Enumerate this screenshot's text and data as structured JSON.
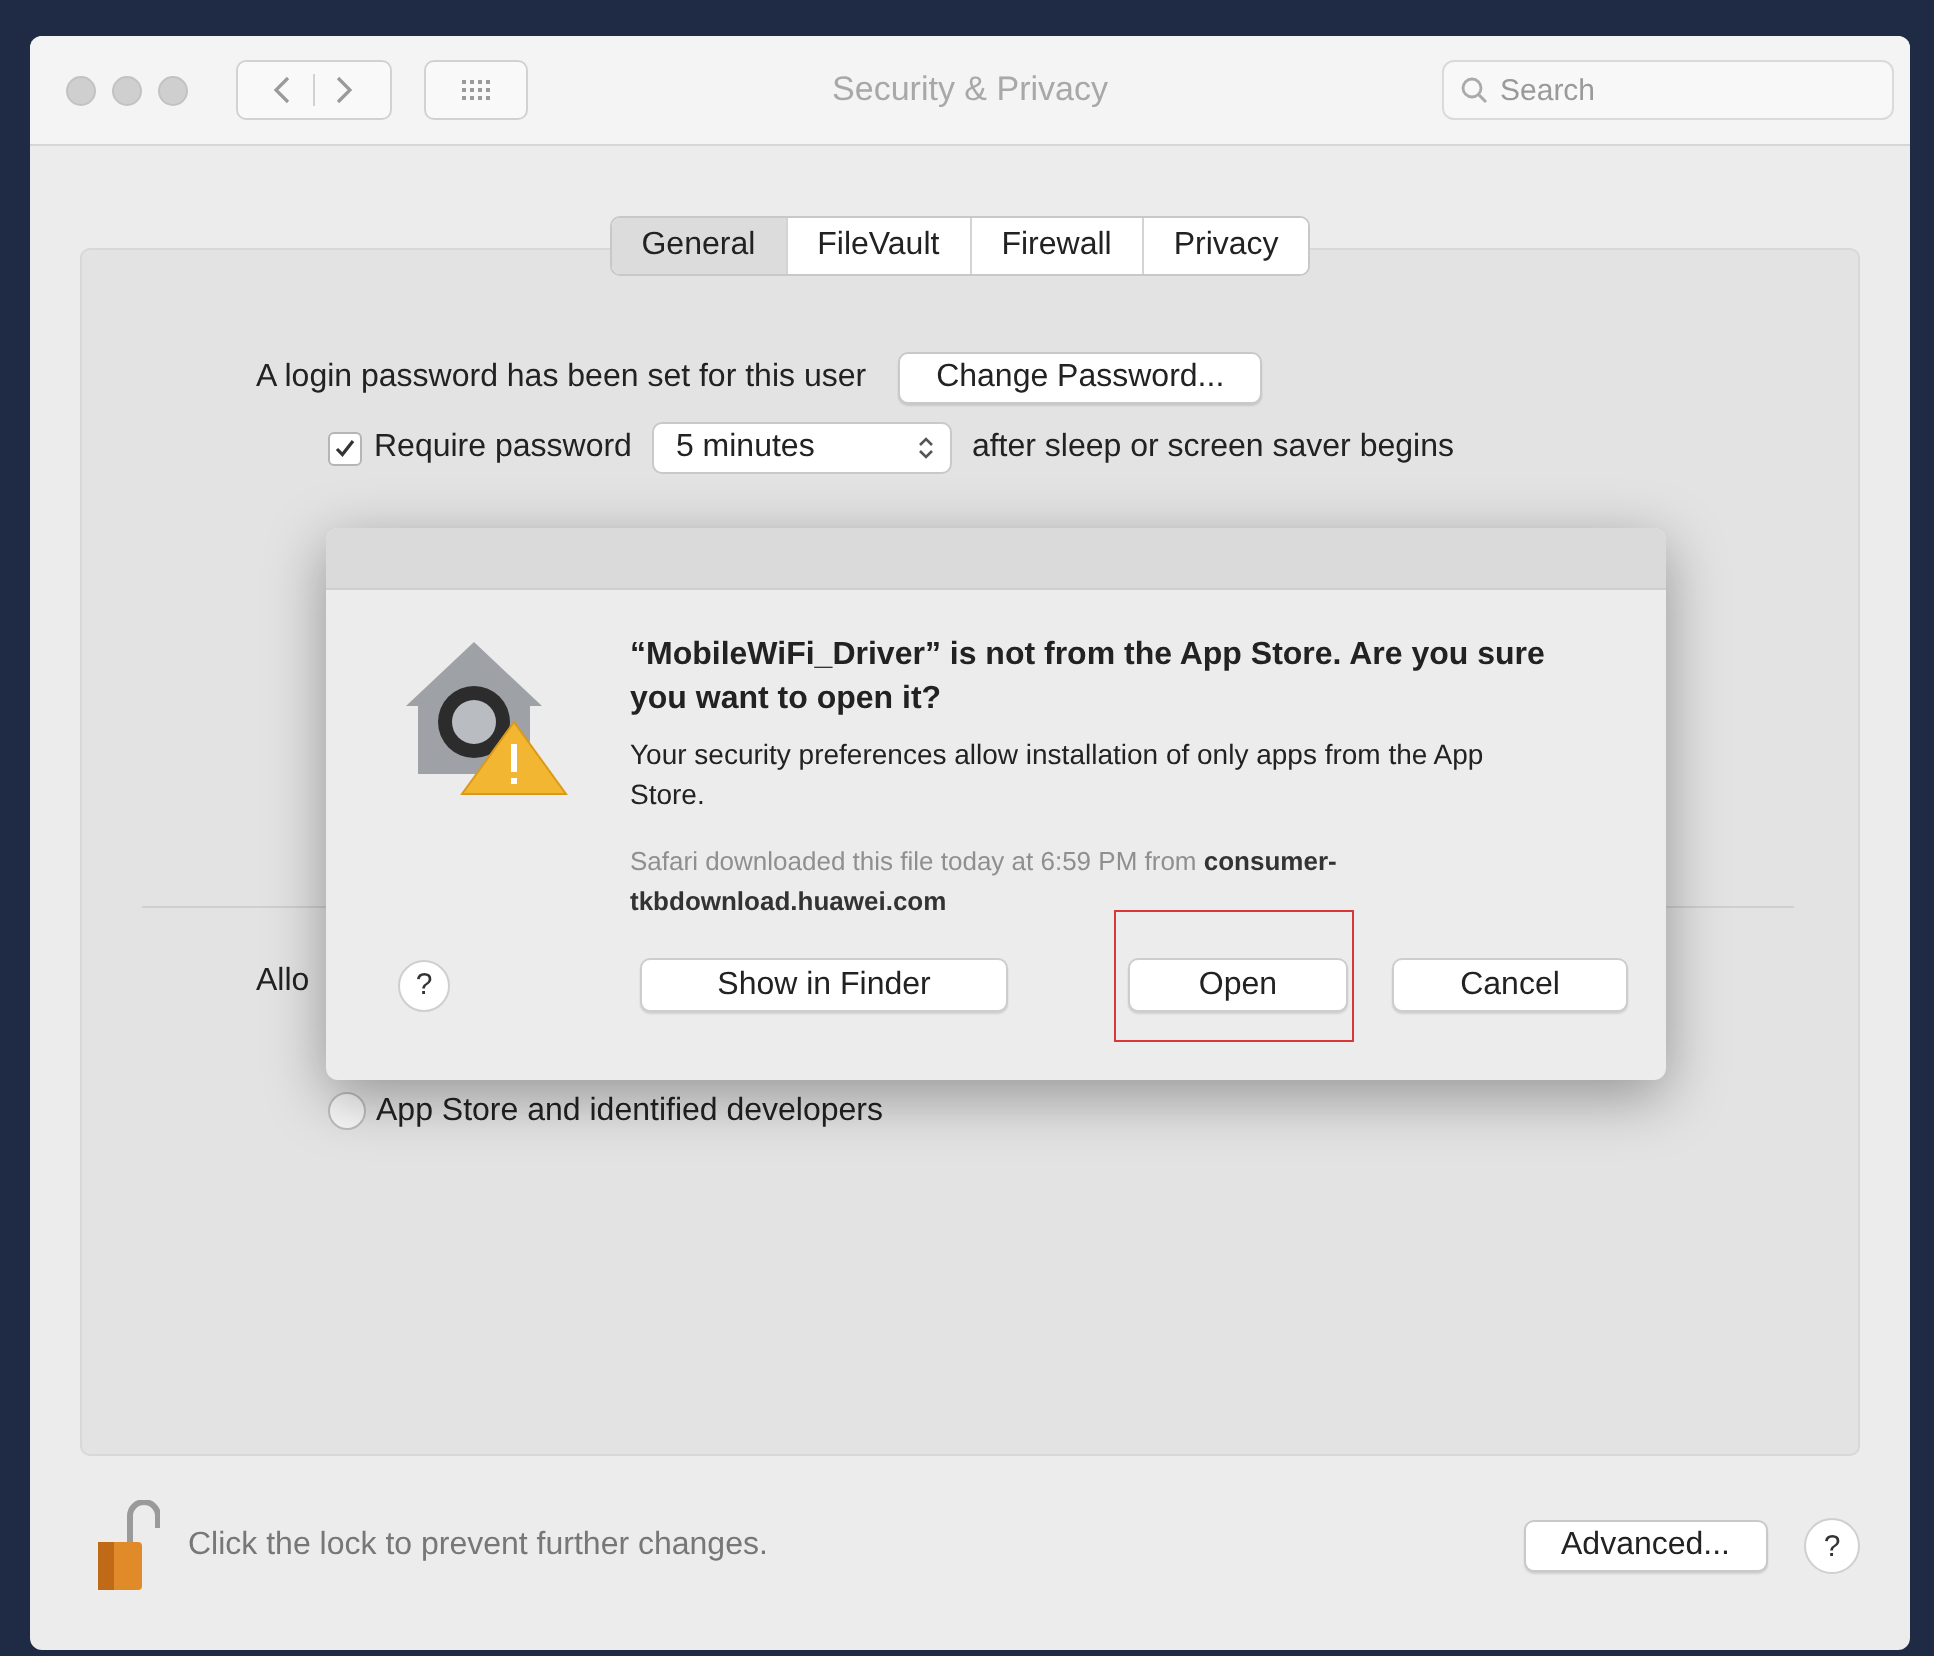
{
  "window": {
    "title": "Security & Privacy"
  },
  "search": {
    "placeholder": "Search"
  },
  "tabs": [
    {
      "label": "General",
      "selected": true
    },
    {
      "label": "FileVault",
      "selected": false
    },
    {
      "label": "Firewall",
      "selected": false
    },
    {
      "label": "Privacy",
      "selected": false
    }
  ],
  "login": {
    "text": "A login password has been set for this user",
    "button": "Change Password..."
  },
  "require_password": {
    "checked": true,
    "label": "Require password",
    "value": "5 minutes",
    "suffix": "after sleep or screen saver begins"
  },
  "allow_label": "Allo",
  "radio": {
    "label": "App Store and identified developers",
    "selected": false
  },
  "dialog": {
    "title": "“MobileWiFi_Driver” is not from the App Store. Are you sure you want to open it?",
    "message": "Your security preferences allow installation of only apps from the App Store.",
    "source": "Safari downloaded this file today at 6:59 PM from **consumer-tkbdownload.huawei.com**",
    "buttons": [
      {
        "kind": "help",
        "label": "?"
      },
      {
        "kind": "push",
        "label": "Show in Finder",
        "highlighted": false
      },
      {
        "kind": "push",
        "label": "Open",
        "highlighted": true
      },
      {
        "kind": "push",
        "label": "Cancel",
        "highlighted": false
      }
    ]
  },
  "footer": {
    "text": "Click the lock to prevent further changes.",
    "button": "Advanced...",
    "help": "?"
  }
}
